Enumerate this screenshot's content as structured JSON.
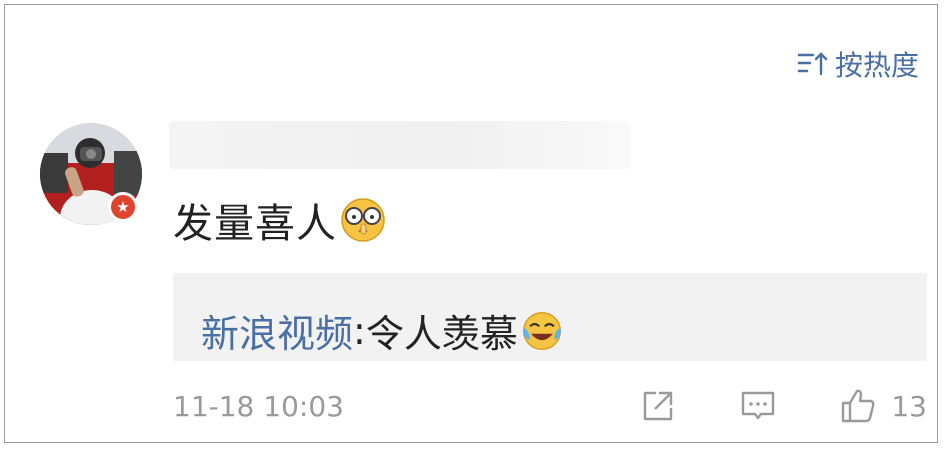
{
  "sort": {
    "label": "按热度",
    "icon": "sort-icon"
  },
  "comment": {
    "author_avatar": "avatar",
    "badge_icon": "star-badge-icon",
    "text": "发量喜人",
    "emoji": "nose-pick-glasses-emoji",
    "reply": {
      "user": "新浪视频",
      "separator": ": ",
      "text": "令人羡慕",
      "emoji": "laugh-cry-emoji"
    },
    "timestamp": "11-18 10:03",
    "like_count": "13"
  },
  "colors": {
    "link": "#4a6fa5",
    "muted": "#9a9a9a",
    "text": "#222222",
    "badge": "#e0442f",
    "reply_bg": "#f2f2f2"
  }
}
